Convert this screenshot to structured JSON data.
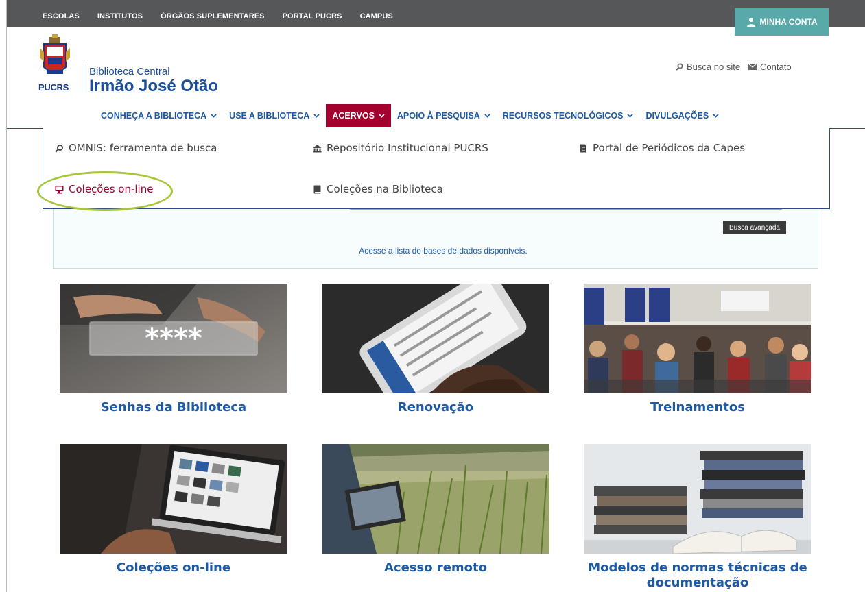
{
  "topbar": {
    "links": [
      "ESCOLAS",
      "INSTITUTOS",
      "ÓRGÃOS SUPLEMENTARES",
      "PORTAL PUCRS",
      "CAMPUS"
    ],
    "account_label": "MINHA CONTA"
  },
  "logo": {
    "brand": "PUCRS",
    "subtitle": "Biblioteca Central",
    "title": "Irmão José Otão"
  },
  "header_tools": {
    "search_label": "Busca no site",
    "contact_label": "Contato"
  },
  "nav": {
    "items": [
      {
        "label": "CONHEÇA A BIBLIOTECA"
      },
      {
        "label": "USE A BIBLIOTECA"
      },
      {
        "label": "ACERVOS"
      },
      {
        "label": "APOIO À PESQUISA"
      },
      {
        "label": "RECURSOS TECNOLÓGICOS"
      },
      {
        "label": "DIVULGAÇÕES"
      }
    ],
    "active": "ACERVOS"
  },
  "dropdown": {
    "items": [
      {
        "label": "OMNIS: ferramenta de busca",
        "icon": "search-icon"
      },
      {
        "label": "Repositório Institucional PUCRS",
        "icon": "building-icon"
      },
      {
        "label": "Portal de Periódicos da Capes",
        "icon": "document-icon"
      },
      {
        "label": "Coleções on-line",
        "icon": "monitor-icon"
      },
      {
        "label": "Coleções na Biblioteca",
        "icon": "book-icon"
      }
    ]
  },
  "search": {
    "advanced_label": "Busca avançada",
    "databases_link": "Acesse a lista de bases de dados disponíveis."
  },
  "cards": [
    {
      "title": "Senhas da Biblioteca",
      "image_text": "****"
    },
    {
      "title": "Renovação"
    },
    {
      "title": "Treinamentos"
    },
    {
      "title": "Coleções on-line"
    },
    {
      "title": "Acesso remoto"
    },
    {
      "title": "Modelos de normas técnicas de documentação"
    }
  ],
  "colors": {
    "topbar": "#555759",
    "accent": "#a3002f",
    "link": "#1c5aa6",
    "account_button": "#5aa9a9",
    "highlight_ring": "#a7c639"
  }
}
